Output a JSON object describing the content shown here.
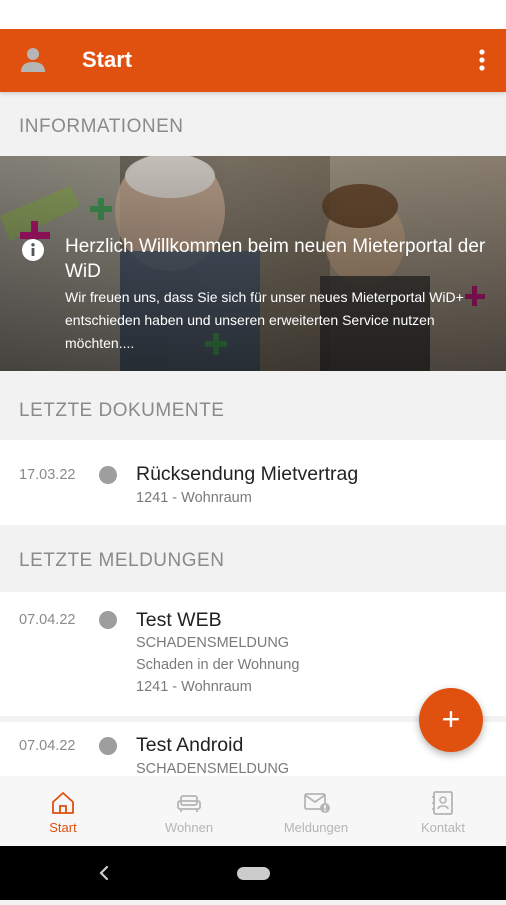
{
  "appbar": {
    "title": "Start",
    "avatar_icon": "person-icon",
    "menu_icon": "more-vert-icon",
    "color": "#e0500f"
  },
  "sections": {
    "informationen": "INFORMATIONEN",
    "dokumente": "LETZTE DOKUMENTE",
    "meldungen": "LETZTE MELDUNGEN"
  },
  "banner": {
    "title": "Herzlich Willkommen beim neuen Mieterportal der WiD",
    "body": "Wir freuen uns, dass Sie sich für unser neues Mieterportal WiD+ entschieden haben und unseren erweiterten Service nutzen möchten....",
    "icon": "info-icon"
  },
  "documents": [
    {
      "date": "17.03.22",
      "title": "Rücksendung Mietvertrag",
      "subtitle": "1241 - Wohnraum"
    }
  ],
  "reports": [
    {
      "date": "07.04.22",
      "title": "Test WEB",
      "type": "SCHADENSMELDUNG",
      "description": "Schaden in der Wohnung",
      "unit": "1241 - Wohnraum"
    },
    {
      "date": "07.04.22",
      "title": "Test Android",
      "type": "SCHADENSMELDUNG"
    }
  ],
  "fab": {
    "label": "+",
    "icon": "plus-icon"
  },
  "bottom_nav": [
    {
      "label": "Start",
      "icon": "home-icon",
      "active": true
    },
    {
      "label": "Wohnen",
      "icon": "sofa-icon",
      "active": false
    },
    {
      "label": "Meldungen",
      "icon": "mail-alert-icon",
      "active": false
    },
    {
      "label": "Kontakt",
      "icon": "contact-book-icon",
      "active": false
    }
  ]
}
